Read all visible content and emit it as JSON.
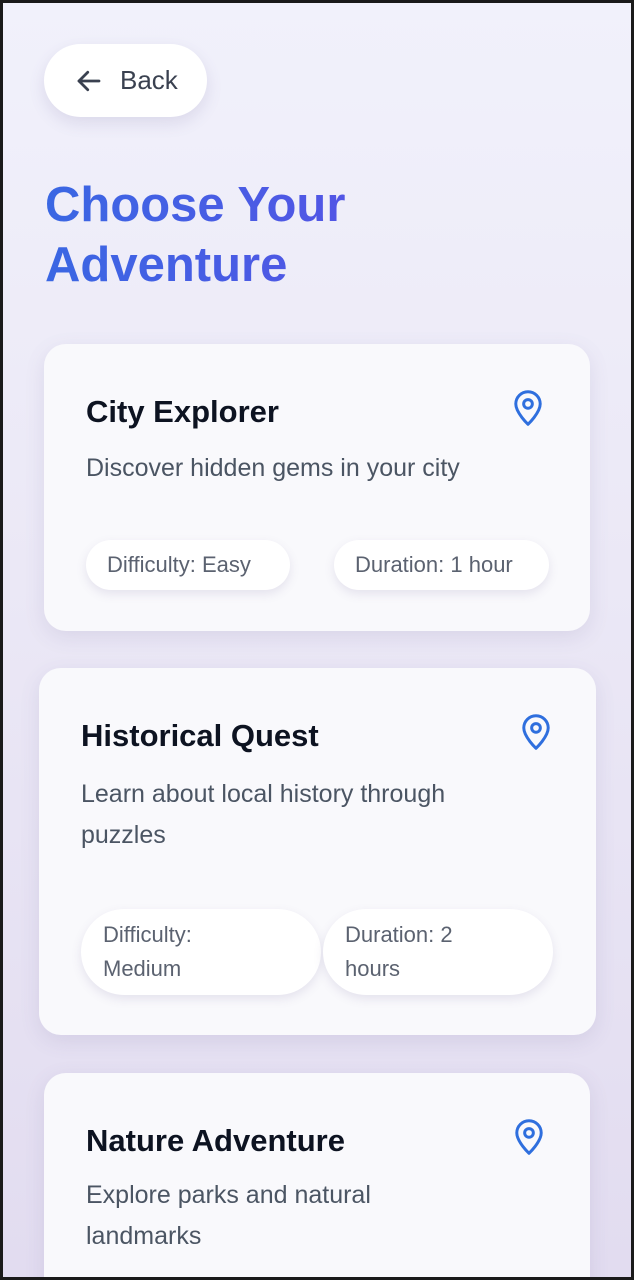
{
  "header": {
    "back_label": "Back",
    "title": "Choose Your Adventure"
  },
  "colors": {
    "accent_blue": "#3a67e3",
    "accent_purple": "#5f4ce6",
    "icon_blue": "#2f6fde"
  },
  "adventures": [
    {
      "title": "City Explorer",
      "description": "Discover hidden gems in your city",
      "difficulty": "Difficulty: Easy",
      "duration": "Duration: 1 hour",
      "icon": "map-pin-icon"
    },
    {
      "title": "Historical Quest",
      "description": "Learn about local history through puzzles",
      "difficulty": "Difficulty: Medium",
      "duration": "Duration: 2 hours",
      "icon": "map-pin-icon"
    },
    {
      "title": "Nature Adventure",
      "description": "Explore parks and natural landmarks",
      "icon": "map-pin-icon"
    }
  ]
}
